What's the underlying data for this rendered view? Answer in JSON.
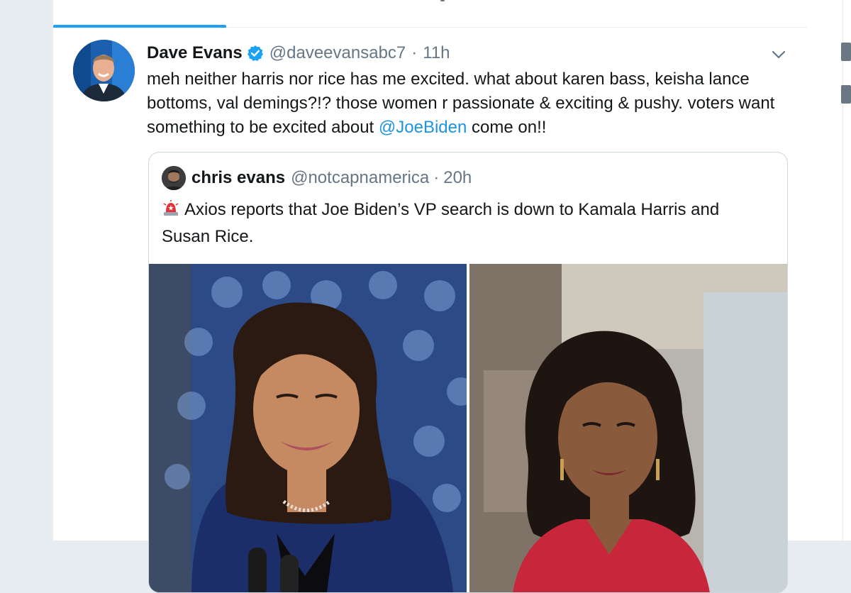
{
  "tweet": {
    "author_name": "Dave Evans",
    "author_handle": "@daveevansabc7",
    "separator": "·",
    "time": "11h",
    "text_before_mention": "meh neither harris nor rice has me excited. what about karen bass, keisha lance bottoms, val demings?!? those women r passionate & exciting & pushy.   voters want something to be excited about ",
    "mention": "@JoeBiden",
    "text_after_mention": " come on!!",
    "verified_icon": "verified-badge-icon",
    "menu_icon": "chevron-down-icon"
  },
  "quoted_tweet": {
    "author_name": "chris evans",
    "author_handle": "@notcapnamerica",
    "separator": "·",
    "time": "20h",
    "emoji_icon": "rotating-light-icon",
    "text": "Axios reports that Joe Biden’s VP search is down to Kamala Harris and Susan Rice."
  },
  "colors": {
    "accent": "#1da1f2",
    "mention": "#1b95e0",
    "secondary_text": "#657786",
    "border": "#e6ecf0"
  }
}
